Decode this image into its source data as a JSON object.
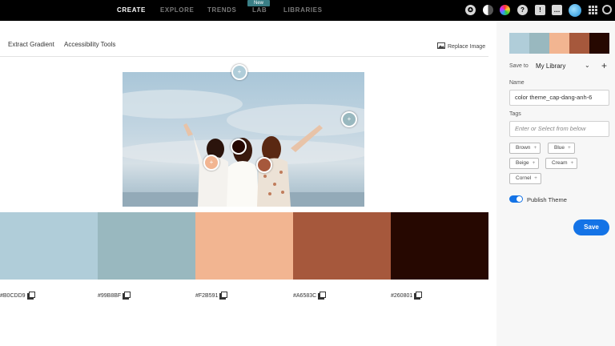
{
  "topnav": {
    "items": [
      "CREATE",
      "EXPLORE",
      "TRENDS",
      "LAB",
      "LIBRARIES"
    ],
    "new_badge": "New",
    "icons": [
      "adobe-cc-icon",
      "contrast-icon",
      "color-wheel-icon",
      "help-icon",
      "alert-icon",
      "chat-icon",
      "profile-icon",
      "apps-grid-icon",
      "creative-cloud-icon"
    ]
  },
  "subnav": {
    "extract_gradient": "Extract Gradient",
    "accessibility_tools": "Accessibility Tools",
    "replace_image": "Replace Image"
  },
  "palette": [
    {
      "hex": "#B0CDD9",
      "label": "#B0CDD9"
    },
    {
      "hex": "#99B8BF",
      "label": "#99B8BF"
    },
    {
      "hex": "#F2B591",
      "label": "#F2B591"
    },
    {
      "hex": "#A6583C",
      "label": "#A6583C"
    },
    {
      "hex": "#260801",
      "label": "#260801"
    }
  ],
  "panel": {
    "save_to_label": "Save to",
    "library": "My Library",
    "name_label": "Name",
    "name_value": "color theme_cap-dang-anh-6",
    "tags_label": "Tags",
    "tags_placeholder": "Enter or Select from below",
    "tags": [
      "Brown",
      "Blue",
      "Beige",
      "Cream",
      "Cornel"
    ],
    "publish_label": "Publish Theme",
    "publish_on": true,
    "save_button": "Save"
  },
  "colors": {
    "accent": "#1473e6",
    "topbar": "#000000"
  }
}
